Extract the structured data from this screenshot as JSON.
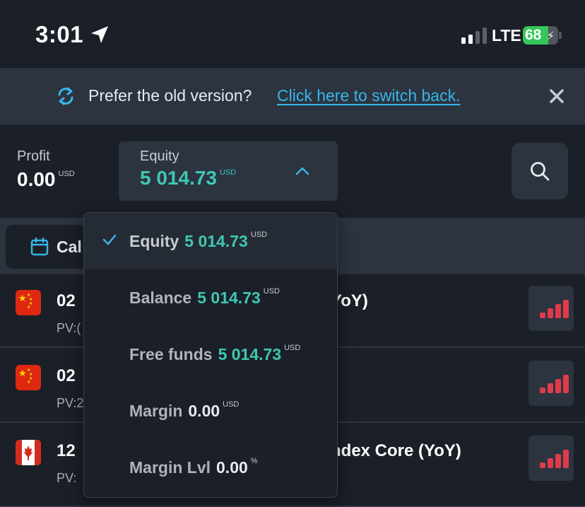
{
  "status_bar": {
    "time": "3:01",
    "network": "LTE",
    "battery": "68"
  },
  "banner": {
    "text": "Prefer the old version?",
    "link": "Click here to switch back."
  },
  "header": {
    "profit_label": "Profit",
    "profit_value": "0.00",
    "profit_currency": "USD",
    "equity_label": "Equity",
    "equity_value": "5 014.73",
    "equity_currency": "USD"
  },
  "filter": {
    "calendar_label": "Cal"
  },
  "events": [
    {
      "title": "02",
      "pv": "PV:(",
      "title_right": "YoY)"
    },
    {
      "title": "02",
      "pv": "PV:2",
      "title_right": ""
    },
    {
      "title": "12",
      "pv": "PV:",
      "title_right": "ndex Core (YoY)"
    }
  ],
  "dropdown": {
    "items": [
      {
        "label": "Equity",
        "value": "5 014.73",
        "unit": "USD",
        "selected": true
      },
      {
        "label": "Balance",
        "value": "5 014.73",
        "unit": "USD",
        "selected": false
      },
      {
        "label": "Free funds",
        "value": "5 014.73",
        "unit": "USD",
        "selected": false
      },
      {
        "label": "Margin",
        "value": "0.00",
        "unit": "USD",
        "selected": false
      },
      {
        "label": "Margin Lvl",
        "value": "0.00",
        "unit": "%",
        "selected": false
      }
    ]
  },
  "colors": {
    "accent_teal": "#3fc7b4",
    "link_blue": "#38b6e8",
    "impact_red": "#e03b4a",
    "background": "#1b1f27",
    "panel": "#2c3440"
  }
}
